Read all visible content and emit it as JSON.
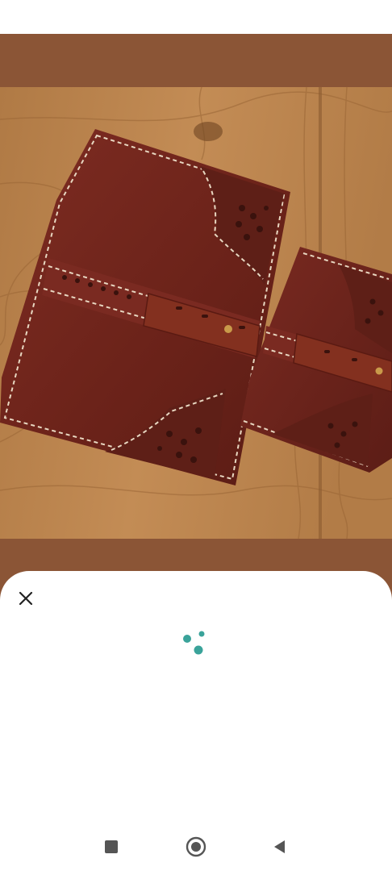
{
  "image": {
    "subject": "leather-planners-photo",
    "backdrop_color": "#8b5536"
  },
  "sheet": {
    "close_icon": "close-icon",
    "loading_icon": "loading-dots-icon",
    "accent_color": "#3aa39a"
  },
  "navigation": {
    "recents_icon": "square-icon",
    "home_icon": "circle-home-icon",
    "back_icon": "triangle-back-icon"
  }
}
